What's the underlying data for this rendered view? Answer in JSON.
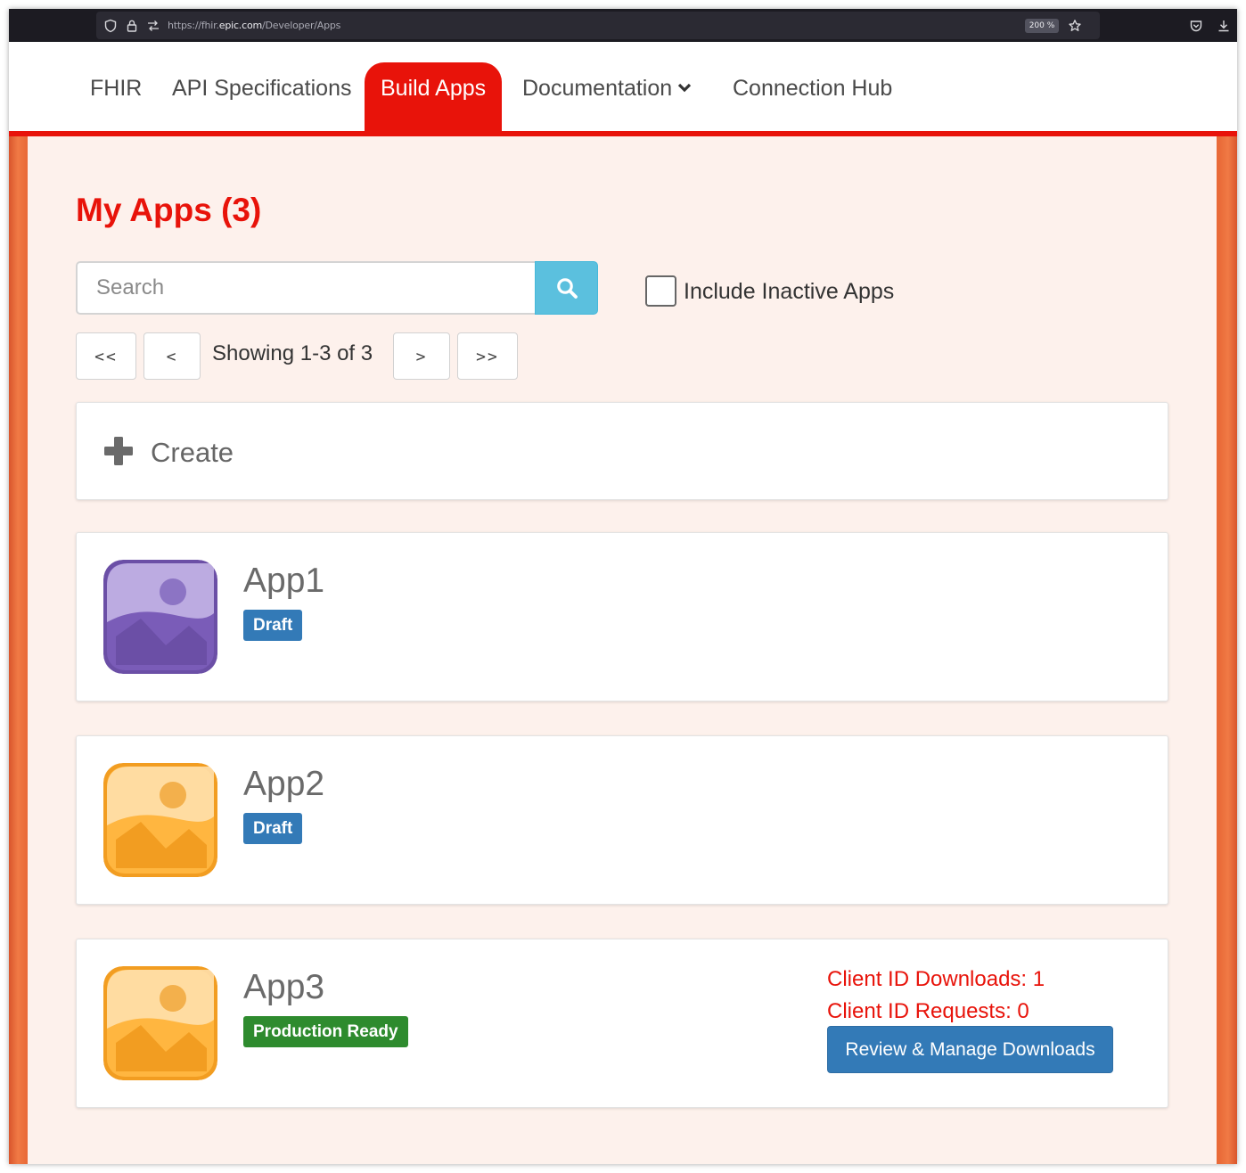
{
  "browser": {
    "url_prefix": "https://fhir.",
    "url_host": "epic.com",
    "url_path": "/Developer/Apps",
    "zoom": "200 %"
  },
  "nav": {
    "items": [
      {
        "label": "FHIR"
      },
      {
        "label": "API Specifications"
      },
      {
        "label": "Build Apps"
      },
      {
        "label": "Documentation"
      },
      {
        "label": "Connection Hub"
      }
    ]
  },
  "page": {
    "title": "My Apps (3)",
    "search_placeholder": "Search",
    "include_inactive_label": "Include Inactive Apps",
    "include_inactive_checked": false,
    "pager": {
      "first": "<<",
      "prev": "<",
      "next": ">",
      "last": ">>",
      "status": "Showing 1-3 of 3"
    },
    "create_label": "Create"
  },
  "apps": [
    {
      "name": "App1",
      "status": "Draft",
      "icon_color": "#6b4fa6"
    },
    {
      "name": "App2",
      "status": "Draft",
      "icon_color": "#f7a932"
    },
    {
      "name": "App3",
      "status": "Production Ready",
      "icon_color": "#f7a932",
      "client_id_downloads": "Client ID Downloads: 1",
      "client_id_requests": "Client ID Requests: 0",
      "action_label": "Review & Manage Downloads"
    }
  ],
  "colors": {
    "brand_red": "#e8130a",
    "draft_badge": "#337ab7",
    "production_badge": "#2e8b2e",
    "search_button": "#5bc0de"
  }
}
